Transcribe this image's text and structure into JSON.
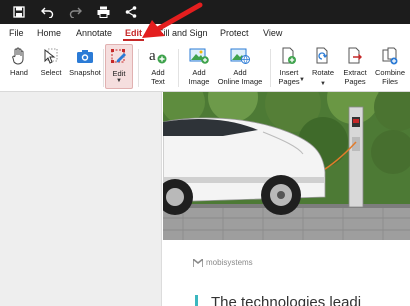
{
  "menu": {
    "items": [
      "File",
      "Home",
      "Annotate",
      "Edit",
      "Fill and Sign",
      "Protect",
      "View"
    ],
    "active": "Edit"
  },
  "ribbon": {
    "hand": "Hand",
    "select": "Select",
    "snapshot": "Snapshot",
    "edit": "Edit",
    "add_text_1": "Add",
    "add_text_2": "Text",
    "add_image_1": "Add",
    "add_image_2": "Image",
    "add_online_1": "Add",
    "add_online_2": "Online Image",
    "insert_1": "Insert",
    "insert_2": "Pages",
    "rotate_1": "Rotate",
    "extract_1": "Extract",
    "extract_2": "Pages",
    "combine_1": "Combine",
    "combine_2": "Files"
  },
  "document": {
    "brand": "mobisystems",
    "headline": "The technologies leadi"
  },
  "colors": {
    "accent": "#c62828",
    "titlebar": "#1c1c1c",
    "quote_bar": "#3bb7bf"
  },
  "icons": [
    "save-icon",
    "undo-icon",
    "redo-icon",
    "print-icon",
    "share-icon",
    "hand-icon",
    "select-icon",
    "snapshot-icon",
    "edit-icon",
    "add-text-icon",
    "add-image-icon",
    "add-online-image-icon",
    "insert-pages-icon",
    "rotate-icon",
    "extract-pages-icon",
    "combine-files-icon"
  ]
}
